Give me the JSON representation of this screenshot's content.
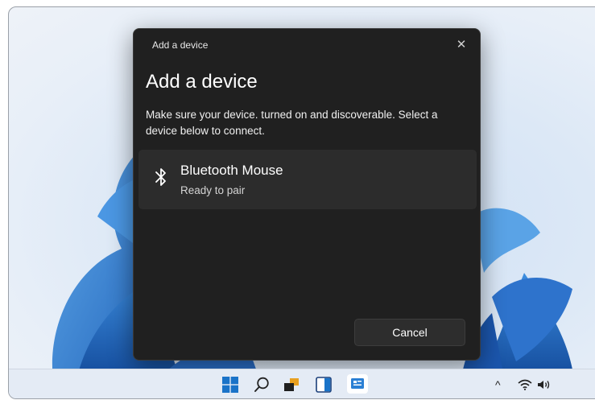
{
  "dialog": {
    "window_title": "Add a device",
    "heading": "Add a device",
    "description": "Make sure your device. turned on and discoverable. Select a device below to connect.",
    "close_glyph": "✕",
    "devices": [
      {
        "name": "Bluetooth Mouse",
        "status": "Ready to pair",
        "icon": "bluetooth-icon"
      }
    ],
    "cancel_label": "Cancel"
  },
  "taskbar": {
    "items": [
      "start-icon",
      "search-icon",
      "task-view-icon",
      "widgets-icon",
      "settings-icon"
    ],
    "tray": [
      "chevron-up-icon",
      "wifi-icon",
      "volume-icon"
    ],
    "chevron_glyph": "^"
  },
  "colors": {
    "dialog_bg": "#202020",
    "device_row_bg": "#2c2c2c",
    "accent": "#1a73c8",
    "taskbar_bg": "#e4ebf5"
  }
}
